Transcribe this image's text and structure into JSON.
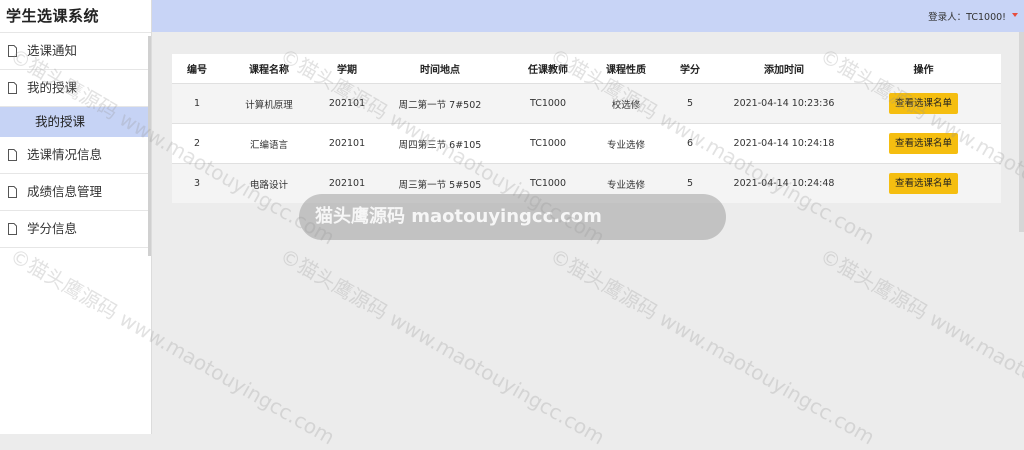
{
  "app": {
    "title": "学生选课系统"
  },
  "header": {
    "user_label": "登录人：TC1000!"
  },
  "sidebar": {
    "items": [
      {
        "label": "选课通知"
      },
      {
        "label": "我的授课",
        "subitems": [
          {
            "label": "我的授课",
            "active": true
          }
        ]
      },
      {
        "label": "选课情况信息"
      },
      {
        "label": "成绩信息管理"
      },
      {
        "label": "学分信息"
      }
    ]
  },
  "table": {
    "columns": [
      "编号",
      "课程名称",
      "学期",
      "时间地点",
      "任课教师",
      "课程性质",
      "学分",
      "添加时间",
      "操作"
    ],
    "rows": [
      {
        "id": "1",
        "course": "计算机原理",
        "term": "202101",
        "time_place": "周二第一节 7#502",
        "teacher": "TC1000",
        "nature": "校选修",
        "credit": "5",
        "added": "2021-04-14 10:23:36",
        "action": "查看选课名单"
      },
      {
        "id": "2",
        "course": "汇编语言",
        "term": "202101",
        "time_place": "周四第三节 6#105",
        "teacher": "TC1000",
        "nature": "专业选修",
        "credit": "6",
        "added": "2021-04-14 10:24:18",
        "action": "查看选课名单"
      },
      {
        "id": "3",
        "course": "电路设计",
        "term": "202101",
        "time_place": "周三第一节 5#505",
        "teacher": "TC1000",
        "nature": "专业选修",
        "credit": "5",
        "added": "2021-04-14 10:24:48",
        "action": "查看选课名单"
      }
    ]
  },
  "watermark": {
    "pill": "猫头鹰源码 maotouyingcc.com",
    "diag": "©猫头鹰源码 www.maotouyingcc.com"
  },
  "colors": {
    "header_bg": "#c8d4f6",
    "active_item": "#c6d3f5",
    "action_button": "#f5be10",
    "caret": "#e74c3c"
  }
}
